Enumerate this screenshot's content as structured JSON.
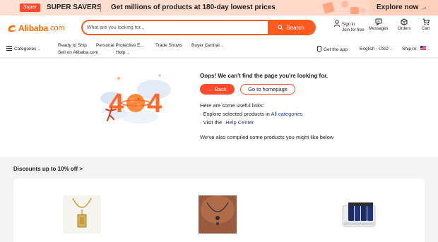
{
  "promo": {
    "badge": "Super",
    "title": "SUPER SAVERS",
    "text": "Get millions of products at 180-day lowest prices",
    "cta": "Explore now →"
  },
  "header": {
    "logo_text": "Alibaba",
    "logo_suffix": ".com",
    "search_placeholder": "What are you looking for...",
    "search_button": "Search",
    "signin_line1": "Sign in",
    "signin_line2": "Join for free",
    "messages": "Messages",
    "orders": "Orders",
    "cart": "Cart"
  },
  "nav": {
    "categories": "Categories",
    "ready_to_ship": "Ready to Ship",
    "ppe": "Personal Protective E...",
    "trade_shows": "Trade Shows",
    "buyer_central": "Buyer Central",
    "sell": "Sell on Alibaba.com",
    "help": "Help",
    "get_app": "Get the app",
    "language": "English - USD",
    "ship_to": "Ship to:"
  },
  "error": {
    "title": "Oops! We can't find the page you're looking for.",
    "back_button": "← Back",
    "home_button": "Go to homepage",
    "help_intro": "Here are some useful links:",
    "explore_prefix": "· Explore selected products in",
    "explore_link": "All categories",
    "visit_prefix": "· Visit the",
    "visit_link": "Help Center",
    "compiled": "We've also compiled some products you might like below"
  },
  "discounts": {
    "title": "Discounts up to 10% off >"
  },
  "colors": {
    "brand": "#ff6a00",
    "accent": "#ff4b2b",
    "link": "#1a3bb5"
  }
}
